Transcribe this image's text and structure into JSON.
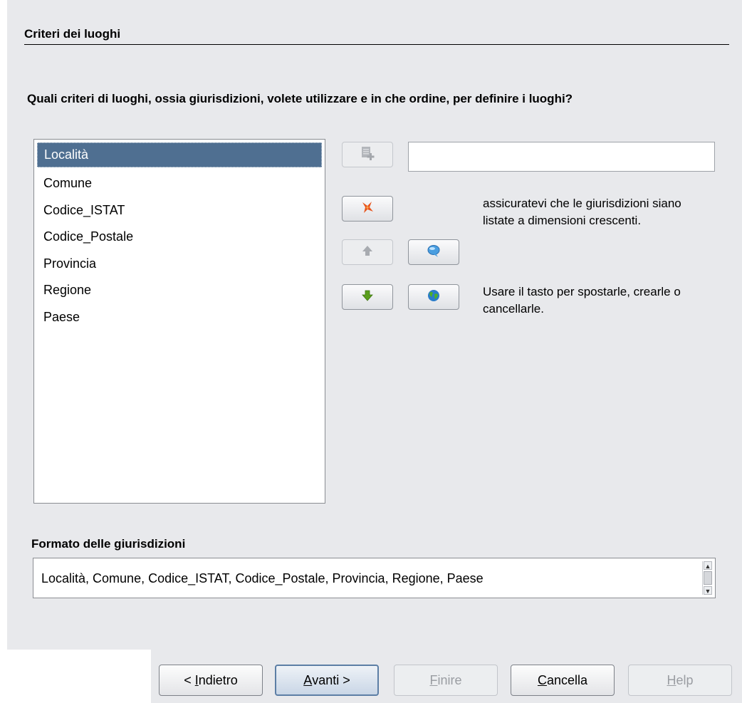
{
  "section": {
    "title": "Criteri dei luoghi"
  },
  "question": "Quali criteri di luoghi, ossia giurisdizioni, volete utilizzare e in che ordine, per definire i luoghi?",
  "jurisdictions": {
    "items": [
      {
        "label": "Località",
        "selected": true
      },
      {
        "label": "Comune"
      },
      {
        "label": "Codice_ISTAT"
      },
      {
        "label": "Codice_Postale"
      },
      {
        "label": "Provincia"
      },
      {
        "label": "Regione"
      },
      {
        "label": "Paese"
      }
    ]
  },
  "name_input": {
    "value": ""
  },
  "tools": {
    "add": {
      "icon": "add-page-icon",
      "enabled": false
    },
    "delete": {
      "icon": "delete-star-icon",
      "enabled": true
    },
    "move_up": {
      "icon": "arrow-up-icon",
      "enabled": false
    },
    "move_down": {
      "icon": "arrow-down-icon",
      "enabled": true
    },
    "comment": {
      "icon": "speech-bubble-icon",
      "enabled": true
    },
    "globe": {
      "icon": "globe-icon",
      "enabled": true
    }
  },
  "hints": {
    "hint1": "assicuratevi che le giurisdizioni siano listate a dimensioni crescenti.",
    "hint2": "Usare il tasto per spostarle, crearle o cancellarle."
  },
  "format": {
    "label": "Formato delle giurisdizioni",
    "value": "Località, Comune, Codice_ISTAT, Codice_Postale, Provincia, Regione, Paese"
  },
  "buttons": {
    "back": {
      "prefix": "< ",
      "mnemonic": "I",
      "rest": "ndietro",
      "enabled": true
    },
    "next": {
      "mnemonic": "A",
      "rest": "vanti >",
      "enabled": true
    },
    "finish": {
      "mnemonic": "F",
      "rest": "inire",
      "enabled": false
    },
    "cancel": {
      "mnemonic": "C",
      "rest": "ancella",
      "enabled": true
    },
    "help": {
      "mnemonic": "H",
      "rest": "elp",
      "enabled": false
    }
  },
  "colors": {
    "dialog_bg": "#e8e9ec",
    "selection": "#4f6f91",
    "delete_icon": "#e8561e",
    "move_down_icon": "#5a9e1c",
    "comment_icon": "#4a9ee0"
  }
}
